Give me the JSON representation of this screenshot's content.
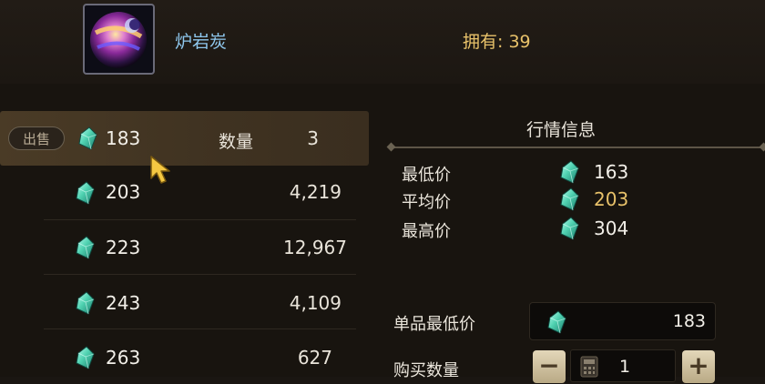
{
  "item": {
    "name": "炉岩炭",
    "owned_label": "拥有:",
    "owned_value": "39",
    "icon": "molten-orb-icon"
  },
  "listings": {
    "sell_button": "出售",
    "quantity_label": "数量",
    "currency_icon": "crystal-gem-icon",
    "rows": [
      {
        "price": "183",
        "qty": "3"
      },
      {
        "price": "203",
        "qty": "4,219"
      },
      {
        "price": "223",
        "qty": "12,967"
      },
      {
        "price": "243",
        "qty": "4,109"
      },
      {
        "price": "263",
        "qty": "627"
      }
    ]
  },
  "market": {
    "title": "行情信息",
    "min_label": "最低价",
    "min_value": "163",
    "avg_label": "平均价",
    "avg_value": "203",
    "max_label": "最高价",
    "max_value": "304"
  },
  "purchase": {
    "unit_min_label": "单品最低价",
    "unit_min_value": "183",
    "buy_qty_label": "购买数量",
    "buy_qty_value": "1",
    "minus": "−",
    "plus": "+"
  },
  "colors": {
    "gold": "#e8c26a",
    "item_name": "#8fc8ee",
    "gem": "#4fd1b0"
  }
}
